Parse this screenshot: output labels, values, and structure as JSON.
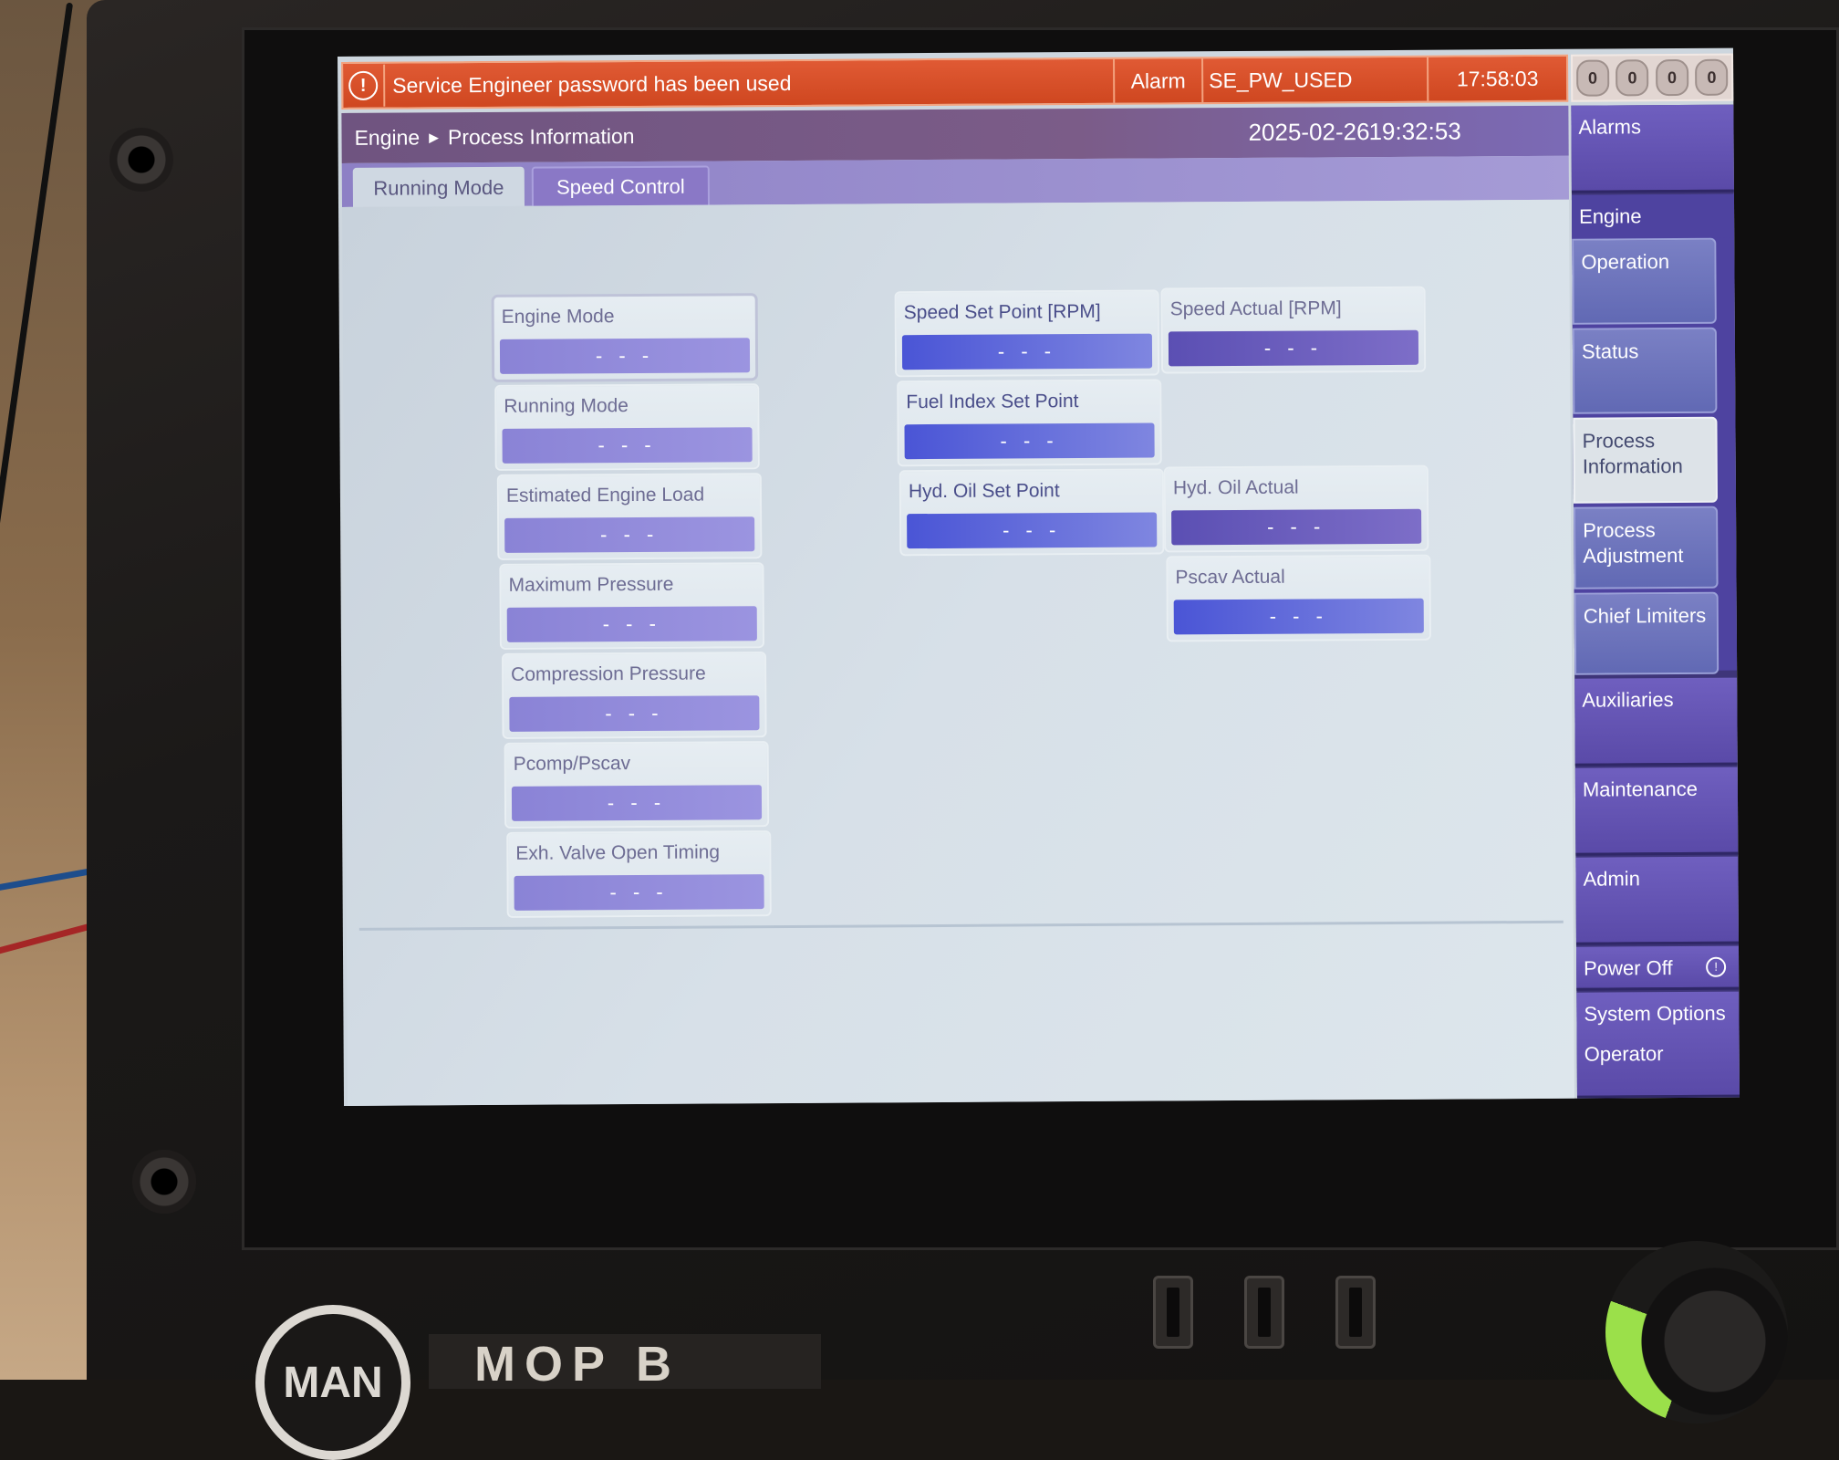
{
  "alarm": {
    "message": "Service Engineer password has been used",
    "type": "Alarm",
    "code": "SE_PW_USED",
    "time": "17:58:03",
    "counters": [
      "0",
      "0",
      "0",
      "0"
    ]
  },
  "header": {
    "breadcrumb": [
      "Engine",
      "Process Information"
    ],
    "date": "2025-02-26",
    "time": "19:32:53"
  },
  "tabs": [
    {
      "label": "Running Mode",
      "active": true
    },
    {
      "label": "Speed Control",
      "active": false
    }
  ],
  "fields": {
    "engine_mode": {
      "label": "Engine Mode",
      "value": "- - -"
    },
    "running_mode": {
      "label": "Running Mode",
      "value": "- - -"
    },
    "estimated_engine_load": {
      "label": "Estimated Engine Load",
      "value": "- - -"
    },
    "maximum_pressure": {
      "label": "Maximum Pressure",
      "value": "- - -"
    },
    "compression_pressure": {
      "label": "Compression Pressure",
      "value": "- - -"
    },
    "pcomp_pscav": {
      "label": "Pcomp/Pscav",
      "value": "- - -"
    },
    "exh_valve_open_timing": {
      "label": "Exh. Valve Open Timing",
      "value": "- - -"
    },
    "speed_set_point": {
      "label": "Speed Set Point [RPM]",
      "value": "- - -"
    },
    "fuel_index_set_point": {
      "label": "Fuel Index Set Point",
      "value": "- - -"
    },
    "hyd_oil_set_point": {
      "label": "Hyd. Oil Set Point",
      "value": "- - -"
    },
    "speed_actual": {
      "label": "Speed Actual [RPM]",
      "value": "- - -"
    },
    "hyd_oil_actual": {
      "label": "Hyd. Oil Actual",
      "value": "- - -"
    },
    "pscav_actual": {
      "label": "Pscav Actual",
      "value": "- - -"
    }
  },
  "sidebar": {
    "alarms": "Alarms",
    "engine": "Engine",
    "operation": "Operation",
    "status": "Status",
    "process_information": "Process Information",
    "process_adjustment": "Process Adjustment",
    "chief_limiters": "Chief Limiters",
    "auxiliaries": "Auxiliaries",
    "maintenance": "Maintenance",
    "admin": "Admin",
    "power_off": "Power Off",
    "system_options": "System Options",
    "operator": "Operator"
  },
  "device": {
    "brand": "MAN",
    "model": "MOP B"
  },
  "colors": {
    "alarm_bar": "#d4502a",
    "header": "#74588a",
    "value_box": "#8a83d6",
    "sidebar": "#5a4aa8"
  }
}
